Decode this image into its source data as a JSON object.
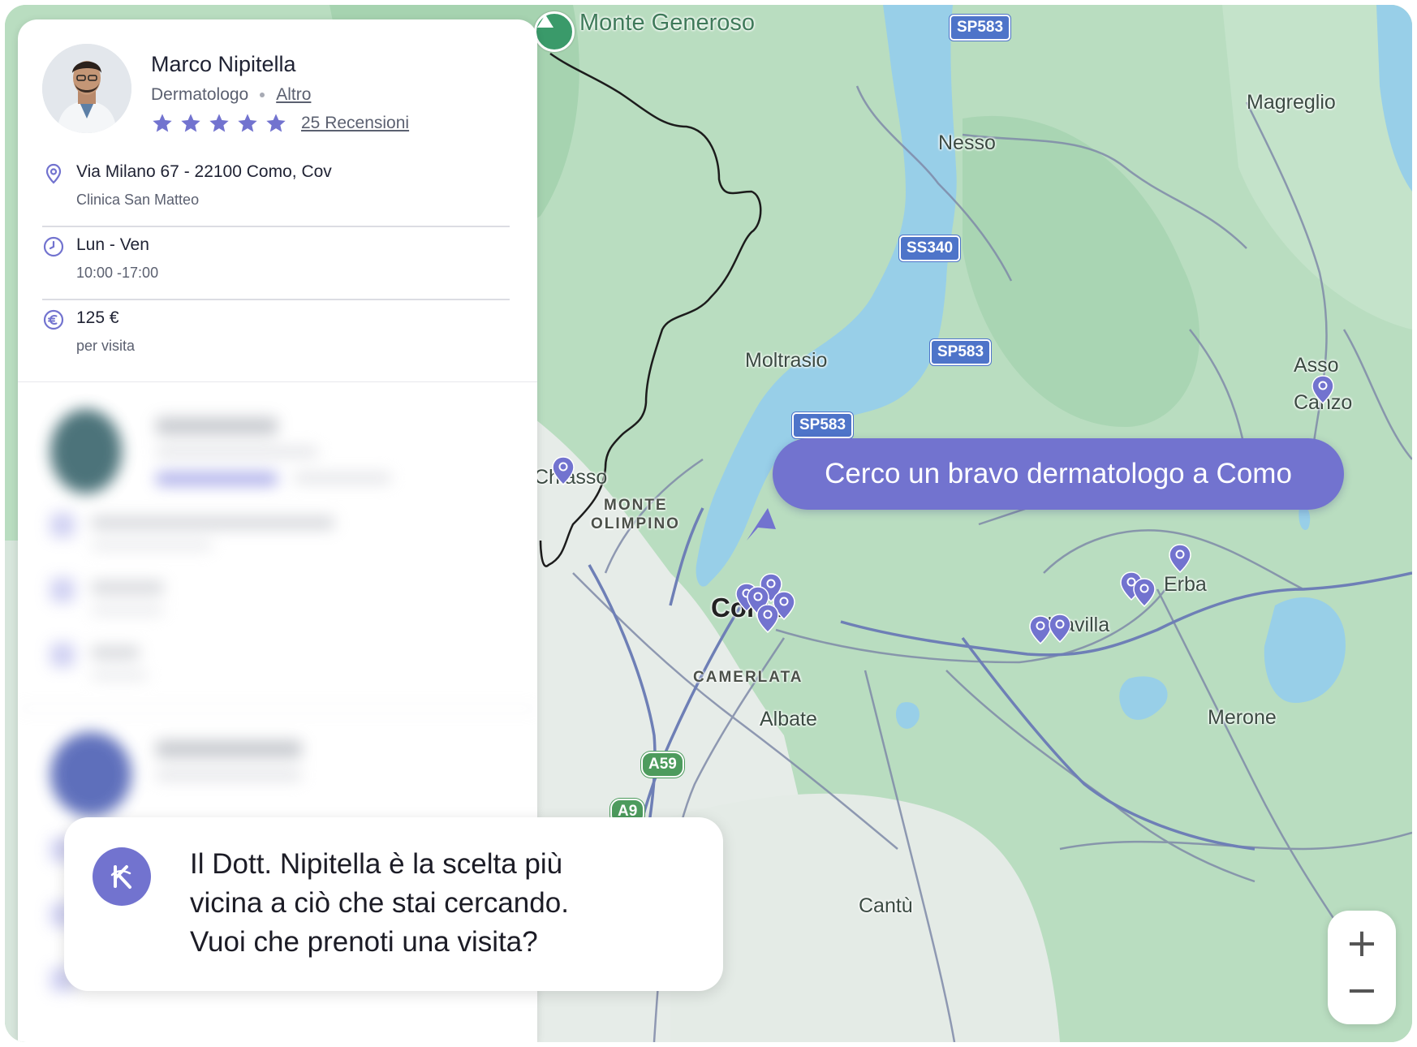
{
  "doctor": {
    "name": "Marco Nipitella",
    "specialty": "Dermatologo",
    "other_link": "Altro",
    "rating_stars": 5,
    "reviews_label": "25 Recensioni",
    "address": "Via Milano 67 - 22100 Como, Cov",
    "clinic": "Clinica San Matteo",
    "days": "Lun - Ven",
    "hours": "10:00 -17:00",
    "price": "125 €",
    "price_unit": "per visita"
  },
  "search": {
    "query": "Cerco un bravo dermatologo a Como"
  },
  "assistant": {
    "line1": "Il Dott. Nipitella è la scelta più",
    "line2": "vicina a ciò che stai cercando.",
    "line3": "Vuoi che prenoti una visita?"
  },
  "map": {
    "places": {
      "monte_generoso": "Monte Generoso",
      "magreglio": "Magreglio",
      "nesso": "Nesso",
      "moltrasio": "Moltrasio",
      "asso": "Asso",
      "canzo": "Canzo",
      "chiasso": "Chiasso",
      "monte_olimpino_1": "MONTE",
      "monte_olimpino_2": "OLIMPINO",
      "como": "Como",
      "erba": "Erba",
      "albavilla": "Albavilla",
      "camerlata": "CAMERLATA",
      "albate": "Albate",
      "merone": "Merone",
      "cantu": "Cantù"
    },
    "roads": {
      "sp583_a": "SP583",
      "ss340": "SS340",
      "sp583_b": "SP583",
      "sp583_c": "SP583",
      "a59": "A59",
      "a9": "A9"
    },
    "zoom_in": "+",
    "zoom_out": "−"
  },
  "colors": {
    "accent": "#7273cf",
    "water": "#98cfe8",
    "land": "#b9ddc0",
    "road_shield": "#4e74c9"
  }
}
